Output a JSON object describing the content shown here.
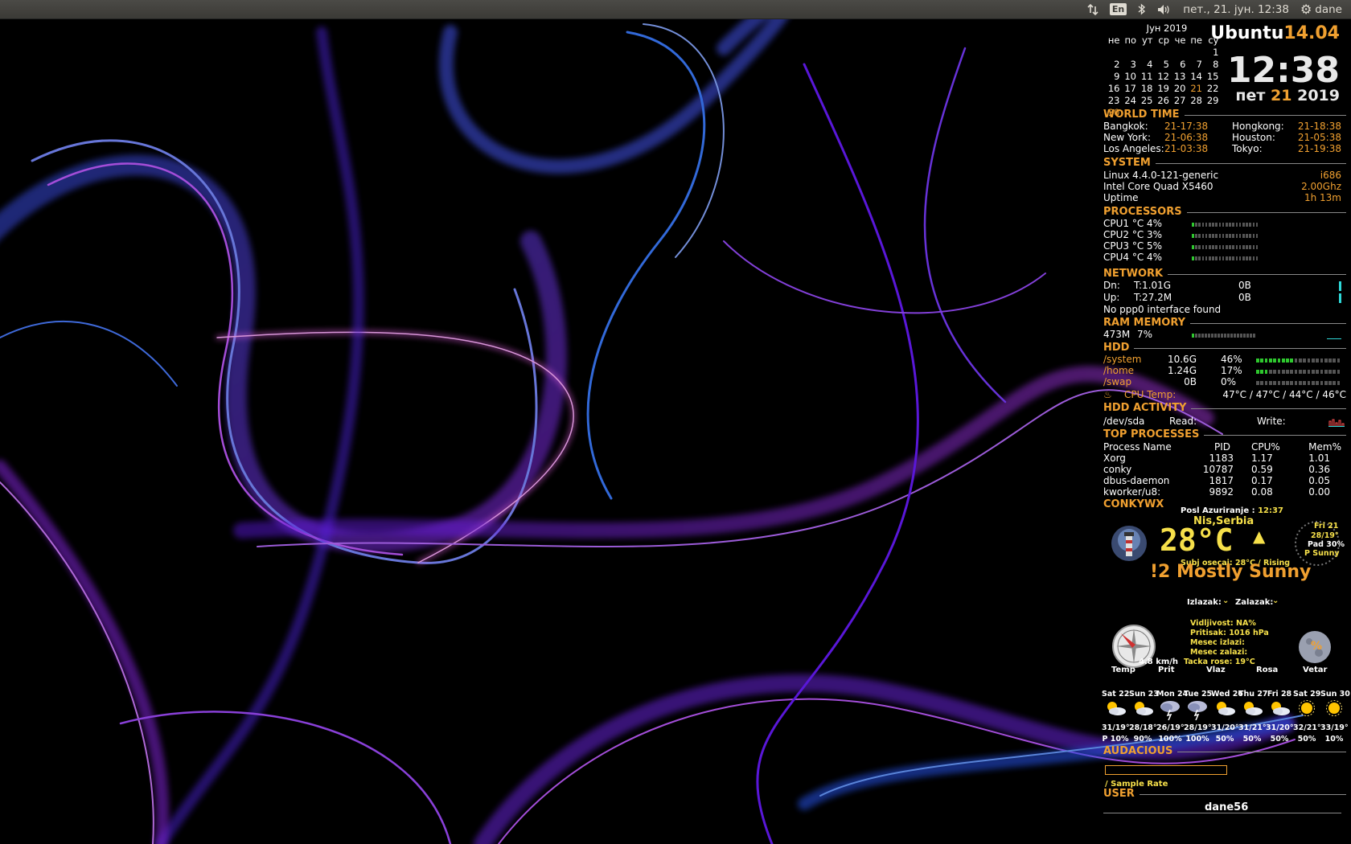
{
  "topbar": {
    "language": "En",
    "datetime": "пет., 21. јун. 12:38",
    "user": "dane",
    "icons": [
      "network-icon",
      "keyboard-lang",
      "bluetooth-icon",
      "volume-icon",
      "gear-icon"
    ]
  },
  "calendar": {
    "month": "Јун  2019",
    "weekdays": [
      "не",
      "по",
      "ут",
      "ср",
      "че",
      "пе",
      "су"
    ],
    "weeks": [
      [
        "",
        "",
        "",
        "",
        "",
        "",
        "1"
      ],
      [
        "2",
        "3",
        "4",
        "5",
        "6",
        "7",
        "8"
      ],
      [
        "9",
        "10",
        "11",
        "12",
        "13",
        "14",
        "15"
      ],
      [
        "16",
        "17",
        "18",
        "19",
        "20",
        "21",
        "22"
      ],
      [
        "23",
        "24",
        "25",
        "26",
        "27",
        "28",
        "29"
      ]
    ],
    "trailing": "30",
    "today": "21"
  },
  "header": {
    "distro_name": "Ubuntu",
    "distro_version": "14.04",
    "time": "12:38",
    "date_day": "пет",
    "date_num": "21",
    "date_year": "2019"
  },
  "world_time": {
    "title": "WORLD TIME",
    "rows": [
      {
        "c1": "Bangkok:",
        "t1": "21-17:38",
        "c2": "Hongkong:",
        "t2": "21-18:38"
      },
      {
        "c1": "New York:",
        "t1": "21-06:38",
        "c2": "Houston:",
        "t2": "21-05:38"
      },
      {
        "c1": "Los Angeles:",
        "t1": "21-03:38",
        "c2": "Tokyo:",
        "t2": "21-19:38"
      }
    ]
  },
  "system": {
    "title": "SYSTEM",
    "kernel": "Linux 4.4.0-121-generic",
    "arch": "i686",
    "cpu": "Intel Core Quad X5460",
    "freq": "2.00Ghz",
    "uptime_label": "Uptime",
    "uptime": "1h 13m"
  },
  "processors": {
    "title": "PROCESSORS",
    "cpus": [
      {
        "label": "CPU1 °C 4%",
        "load": 0.04
      },
      {
        "label": "CPU2 °C 3%",
        "load": 0.03
      },
      {
        "label": "CPU3 °C 5%",
        "load": 0.05
      },
      {
        "label": "CPU4 °C 4%",
        "load": 0.04
      }
    ]
  },
  "network": {
    "title": "NETWORK",
    "dn_label": "Dn:",
    "dn_total": "T:1.01G",
    "dn_rate": "0B",
    "up_label": "Up:",
    "up_total": "T:27.2M",
    "up_rate": "0B",
    "ppp": "No ppp0 interface found"
  },
  "ram": {
    "title": "RAM MEMORY",
    "used": "473M",
    "percent": "7%",
    "load": 0.07
  },
  "hdd": {
    "title": "HDD",
    "mounts": [
      {
        "name": "/system",
        "size": "10.6G",
        "pct": "46%",
        "load": 0.46
      },
      {
        "name": "/home",
        "size": "1.24G",
        "pct": "17%",
        "load": 0.17
      },
      {
        "name": "/swap",
        "size": "0B",
        "pct": "0%",
        "load": 0
      }
    ],
    "cpu_temp_label": "CPU Temp:",
    "cpu_temp": "47°C / 47°C / 44°C / 46°C"
  },
  "hdd_activity": {
    "title": "HDD ACTIVITY",
    "device": "/dev/sda",
    "read": "Read:",
    "write": "Write:"
  },
  "top_processes": {
    "title": "TOP PROCESSES",
    "headers": [
      "Process Name",
      "PID",
      "CPU%",
      "Mem%"
    ],
    "rows": [
      [
        "Xorg",
        "1183",
        "1.17",
        "1.01"
      ],
      [
        "conky",
        "10787",
        "0.59",
        "0.36"
      ],
      [
        "dbus-daemon",
        "1817",
        "0.17",
        "0.05"
      ],
      [
        "kworker/u8:",
        "9892",
        "0.08",
        "0.00"
      ]
    ]
  },
  "weather": {
    "title": "CONKYWX",
    "updated_label": "Posl Azuriranje :",
    "updated": "12:37",
    "location": "Nis,Serbia",
    "temp": "28°C",
    "feels": "Subj osecaj: 28°C / Rising",
    "today_day": "Fri 21",
    "today_temp": "28/19°",
    "today_pad": "Pad 30%",
    "today_cond": "P Sunny",
    "condition": "!2 Mostly Sunny",
    "sunrise": "Izlazak:",
    "sunset": "Zalazak:",
    "visibility": "Vidljivost: NA%",
    "pressure": "Pritisak: 1016 hPa",
    "moonrise": "Mesec izlazi:",
    "moonset": "Mesec zalazi:",
    "dewpoint": "Tacka rose: 19°C",
    "wind": "4.8 km/h",
    "moon_glyph": "%",
    "labels": [
      "Temp",
      "Prit",
      "Vlaz",
      "Rosa",
      "Vetar"
    ],
    "forecast": [
      {
        "day": "Sat 22",
        "temp": "31/19°",
        "pad": "P 10%",
        "icon": "partly-sunny"
      },
      {
        "day": "Sun 23",
        "temp": "28/18°",
        "pad": "90%",
        "icon": "partly-sunny"
      },
      {
        "day": "Mon 24",
        "temp": "26/19°",
        "pad": "100%",
        "icon": "storm"
      },
      {
        "day": "Tue 25",
        "temp": "28/19°",
        "pad": "100%",
        "icon": "storm"
      },
      {
        "day": "Wed 26",
        "temp": "31/20°",
        "pad": "50%",
        "icon": "partly-sunny"
      },
      {
        "day": "Thu 27",
        "temp": "31/21°",
        "pad": "50%",
        "icon": "partly-sunny"
      },
      {
        "day": "Fri 28",
        "temp": "31/20°",
        "pad": "50%",
        "icon": "partly-sunny"
      },
      {
        "day": "Sat 29",
        "temp": "32/21°",
        "pad": "50%",
        "icon": "sunny"
      },
      {
        "day": "Sun 30",
        "temp": "33/19°",
        "pad": "10%",
        "icon": "sunny"
      }
    ]
  },
  "audacious": {
    "title": "AUDACIOUS",
    "sample": "/  Sample Rate"
  },
  "user": {
    "title": "USER",
    "name": "dane56"
  },
  "colors": {
    "accent": "#f0a030",
    "weather_yellow": "#f6e04a",
    "bar_green": "#2ec82e",
    "net_cyan": "#2ed8d8"
  }
}
